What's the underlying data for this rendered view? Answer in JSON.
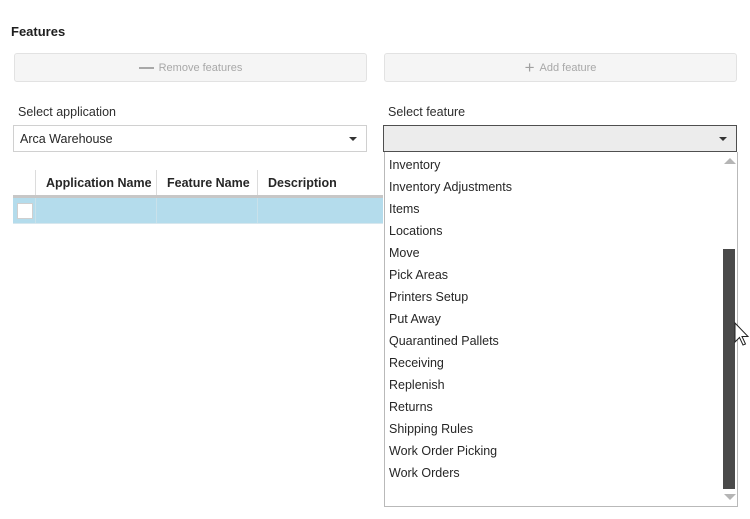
{
  "page": {
    "section_title": "Features"
  },
  "toolbar": {
    "remove_label": "Remove features",
    "remove_icon": "minus-icon",
    "add_label": "Add feature",
    "add_icon": "plus-icon",
    "add_icon_glyph": "+"
  },
  "application_select": {
    "label": "Select application",
    "value": "Arca Warehouse"
  },
  "feature_select": {
    "label": "Select feature",
    "value": "",
    "expanded": true,
    "options": [
      "Inventory",
      "Inventory Adjustments",
      "Items",
      "Locations",
      "Move",
      "Pick Areas",
      "Printers Setup",
      "Put Away",
      "Quarantined Pallets",
      "Receiving",
      "Replenish",
      "Returns",
      "Shipping Rules",
      "Work Order Picking",
      "Work Orders"
    ]
  },
  "grid": {
    "columns": [
      "Application Name",
      "Feature Name",
      "Description"
    ],
    "rows": [
      {
        "checked": false,
        "application_name": "",
        "feature_name": "",
        "description": "",
        "selected": true
      }
    ]
  },
  "colors": {
    "selected_row": "#b4dcec",
    "scroll_thumb": "#4a4a4a",
    "disabled_text": "#a8a8a8"
  }
}
